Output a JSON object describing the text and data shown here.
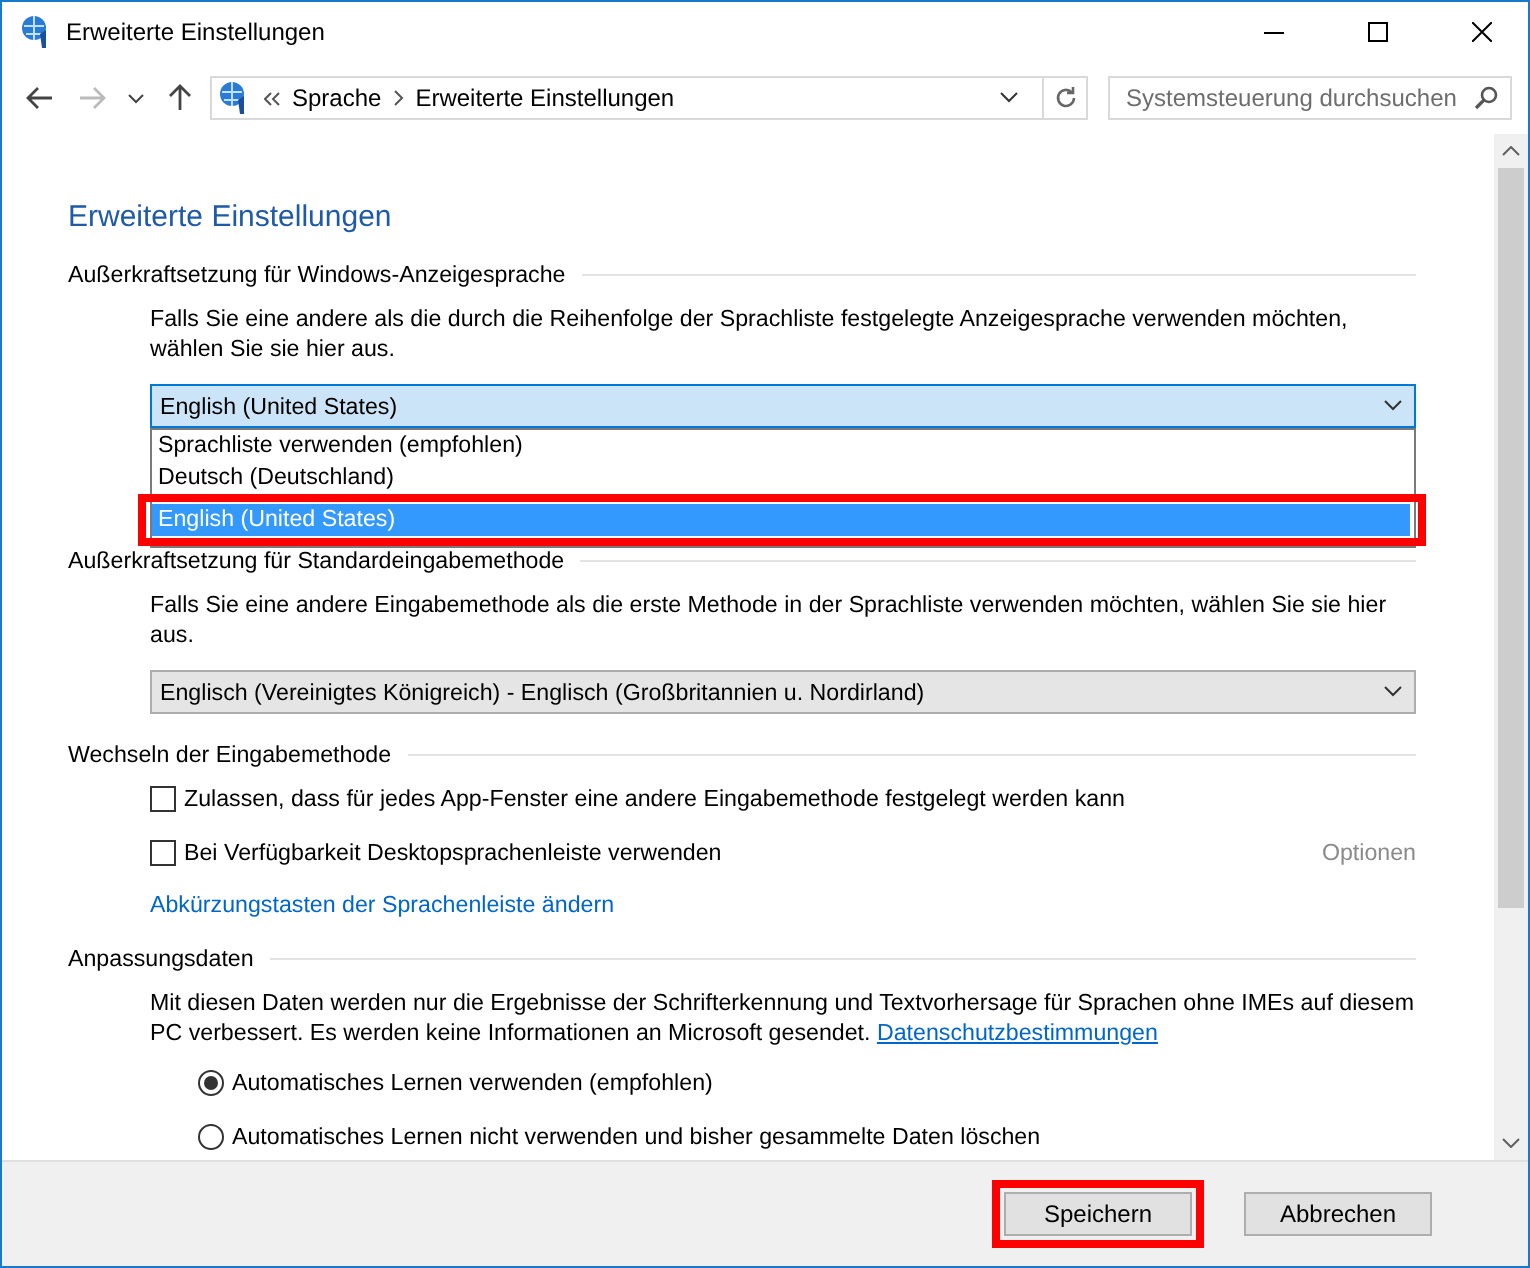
{
  "window": {
    "title": "Erweiterte Einstellungen"
  },
  "address": {
    "breadcrumb": [
      "Sprache",
      "Erweiterte Einstellungen"
    ],
    "search_placeholder": "Systemsteuerung durchsuchen"
  },
  "page_title": "Erweiterte Einstellungen",
  "sections": [
    {
      "heading": "Außerkraftsetzung für Windows-Anzeigesprache",
      "items": [
        {
          "kind": "text",
          "text": "Falls Sie eine andere als die durch die Reihenfolge der Sprachliste festgelegte Anzeigesprache verwenden möchten, wählen Sie sie hier aus."
        },
        {
          "kind": "select",
          "value": "English (United States)",
          "expanded": true,
          "options": [
            {
              "label": "Sprachliste verwenden (empfohlen)",
              "selected": false,
              "highlighted": false
            },
            {
              "label": "Deutsch (Deutschland)",
              "selected": false,
              "highlighted": false
            },
            {
              "label": "English (United States)",
              "selected": true,
              "highlighted": true
            }
          ]
        }
      ]
    },
    {
      "heading": "Außerkraftsetzung für Standardeingabemethode",
      "items": [
        {
          "kind": "text",
          "text": "Falls Sie eine andere Eingabemethode als die erste Methode in der Sprachliste verwenden möchten, wählen Sie sie hier aus."
        },
        {
          "kind": "select",
          "value": "Englisch (Vereinigtes Königreich) - Englisch (Großbritannien u. Nordirland)",
          "expanded": false
        }
      ]
    },
    {
      "heading": "Wechseln der Eingabemethode",
      "items": [
        {
          "kind": "checkbox",
          "label": "Zulassen, dass für jedes App-Fenster eine andere Eingabemethode festgelegt werden kann",
          "checked": false
        },
        {
          "kind": "checkbox",
          "label": "Bei Verfügbarkeit Desktopsprachenleiste verwenden",
          "checked": false,
          "aside": {
            "label": "Optionen",
            "disabled": true
          }
        },
        {
          "kind": "link",
          "text": "Abkürzungstasten der Sprachenleiste ändern"
        }
      ]
    },
    {
      "heading": "Anpassungsdaten",
      "items": [
        {
          "kind": "text",
          "text": "Mit diesen Daten werden nur die Ergebnisse der Schrifterkennung und Textvorhersage für Sprachen ohne IMEs auf diesem PC verbessert. Es werden keine Informationen an Microsoft gesendet.",
          "link": "Datenschutzbestimmungen"
        },
        {
          "kind": "radio",
          "label": "Automatisches Lernen verwenden (empfohlen)",
          "selected": true
        },
        {
          "kind": "radio",
          "label": "Automatisches Lernen nicht verwenden und bisher gesammelte Daten löschen",
          "selected": false
        }
      ]
    }
  ],
  "buttons": [
    {
      "label": "Speichern",
      "highlighted": true
    },
    {
      "label": "Abbrechen",
      "highlighted": false
    }
  ]
}
